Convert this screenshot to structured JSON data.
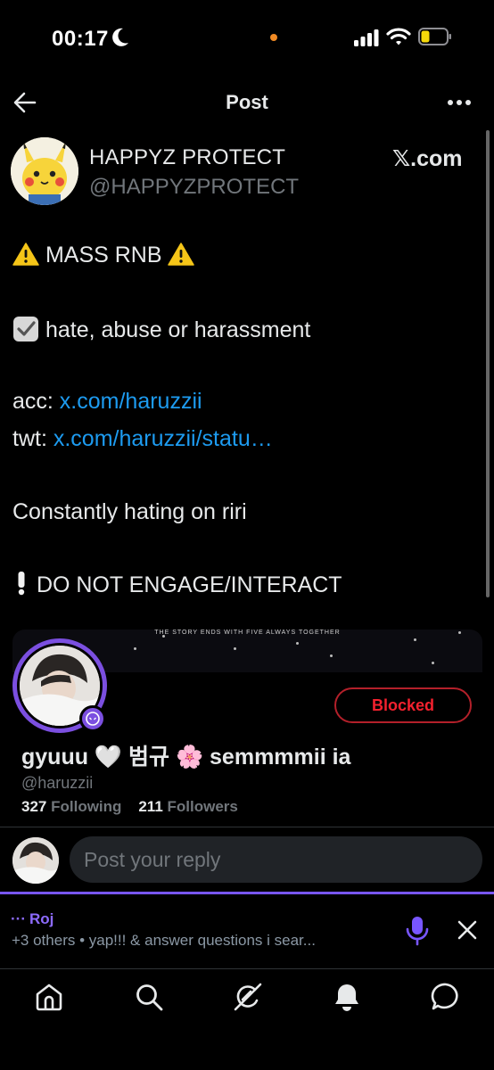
{
  "status_bar": {
    "time": "00:17"
  },
  "nav": {
    "title": "Post"
  },
  "post": {
    "author_name": "HAPPYZ PROTECT",
    "author_handle": "@HAPPYZPROTECT",
    "source_label": "𝕏.com",
    "headline": " MASS RNB ",
    "category": " hate, abuse or harassment",
    "acc_label": "acc: ",
    "acc_link": "x.com/haruzzii",
    "twt_label": "twt:  ",
    "twt_link": "x.com/haruzzii/statu…",
    "reason": "Constantly hating on riri",
    "notice": " DO NOT ENGAGE/INTERACT"
  },
  "embedded_card": {
    "banner_text": "THE STORY ENDS WITH FIVE ALWAYS TOGETHER",
    "name": "gyuuu 🤍 범규 🌸 semmmmii ia",
    "handle": "@haruzzii",
    "following_count": "327",
    "following_label": "Following",
    "followers_count": "211",
    "followers_label": "Followers",
    "blocked_label": "Blocked"
  },
  "reply": {
    "placeholder": "Post your reply"
  },
  "space": {
    "host": "Roj",
    "description": "+3 others • yap!!! & answer questions i sear..."
  },
  "tabs": [
    {
      "icon": "home-icon"
    },
    {
      "icon": "search-icon"
    },
    {
      "icon": "grok-icon"
    },
    {
      "icon": "notifications-icon"
    },
    {
      "icon": "messages-icon"
    }
  ],
  "colors": {
    "link": "#1d9bf0",
    "accent_purple": "#7856ff",
    "blocked_red": "#f4212e",
    "background": "#000000"
  }
}
